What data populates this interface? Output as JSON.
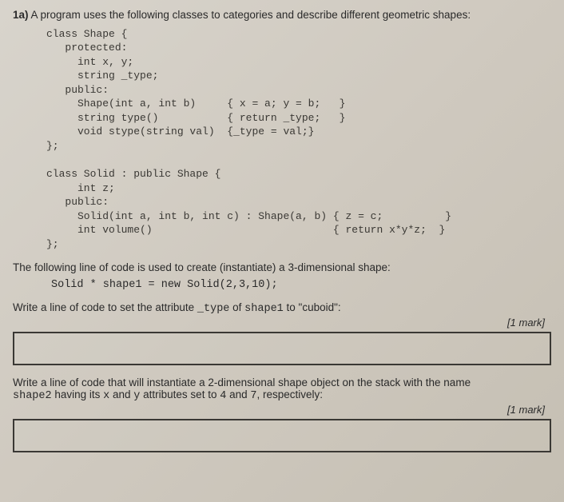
{
  "header": {
    "questionNumber": "1a)",
    "headerText": " A program uses the following classes to categories and describe different geometric shapes:"
  },
  "code1": "class Shape {\n   protected:\n     int x, y;\n     string _type;\n   public:\n     Shape(int a, int b)     { x = a; y = b;   }\n     string type()           { return _type;   }\n     void stype(string val)  {_type = val;}\n};\n\nclass Solid : public Shape {\n     int z;\n   public:\n     Solid(int a, int b, int c) : Shape(a, b) { z = c;          }\n     int volume()                             { return x*y*z;  }\n};",
  "paragraph1": {
    "text": "The following line of code is used to create (instantiate) a 3-dimensional shape:",
    "codeLine": "Solid * shape1 = new Solid(2,3,10);"
  },
  "prompt1": {
    "pre": "Write a line of code to set the attribute ",
    "codeA": "_type",
    "mid": " of ",
    "codeB": "shape1",
    "post": " to \"cuboid\":"
  },
  "mark1": "[1 mark]",
  "prompt2": {
    "line1_pre": "Write a line of code that will instantiate a 2-dimensional shape object on the stack with the name",
    "line2_codeA": "shape2",
    "line2_mid": " having its ",
    "line2_codeB": "x",
    "line2_mid2": " and ",
    "line2_codeC": "y",
    "line2_mid3": " attributes set to ",
    "line2_codeD": "4",
    "line2_mid4": " and ",
    "line2_codeE": "7",
    "line2_post": ", respectively:"
  },
  "mark2": "[1 mark]"
}
